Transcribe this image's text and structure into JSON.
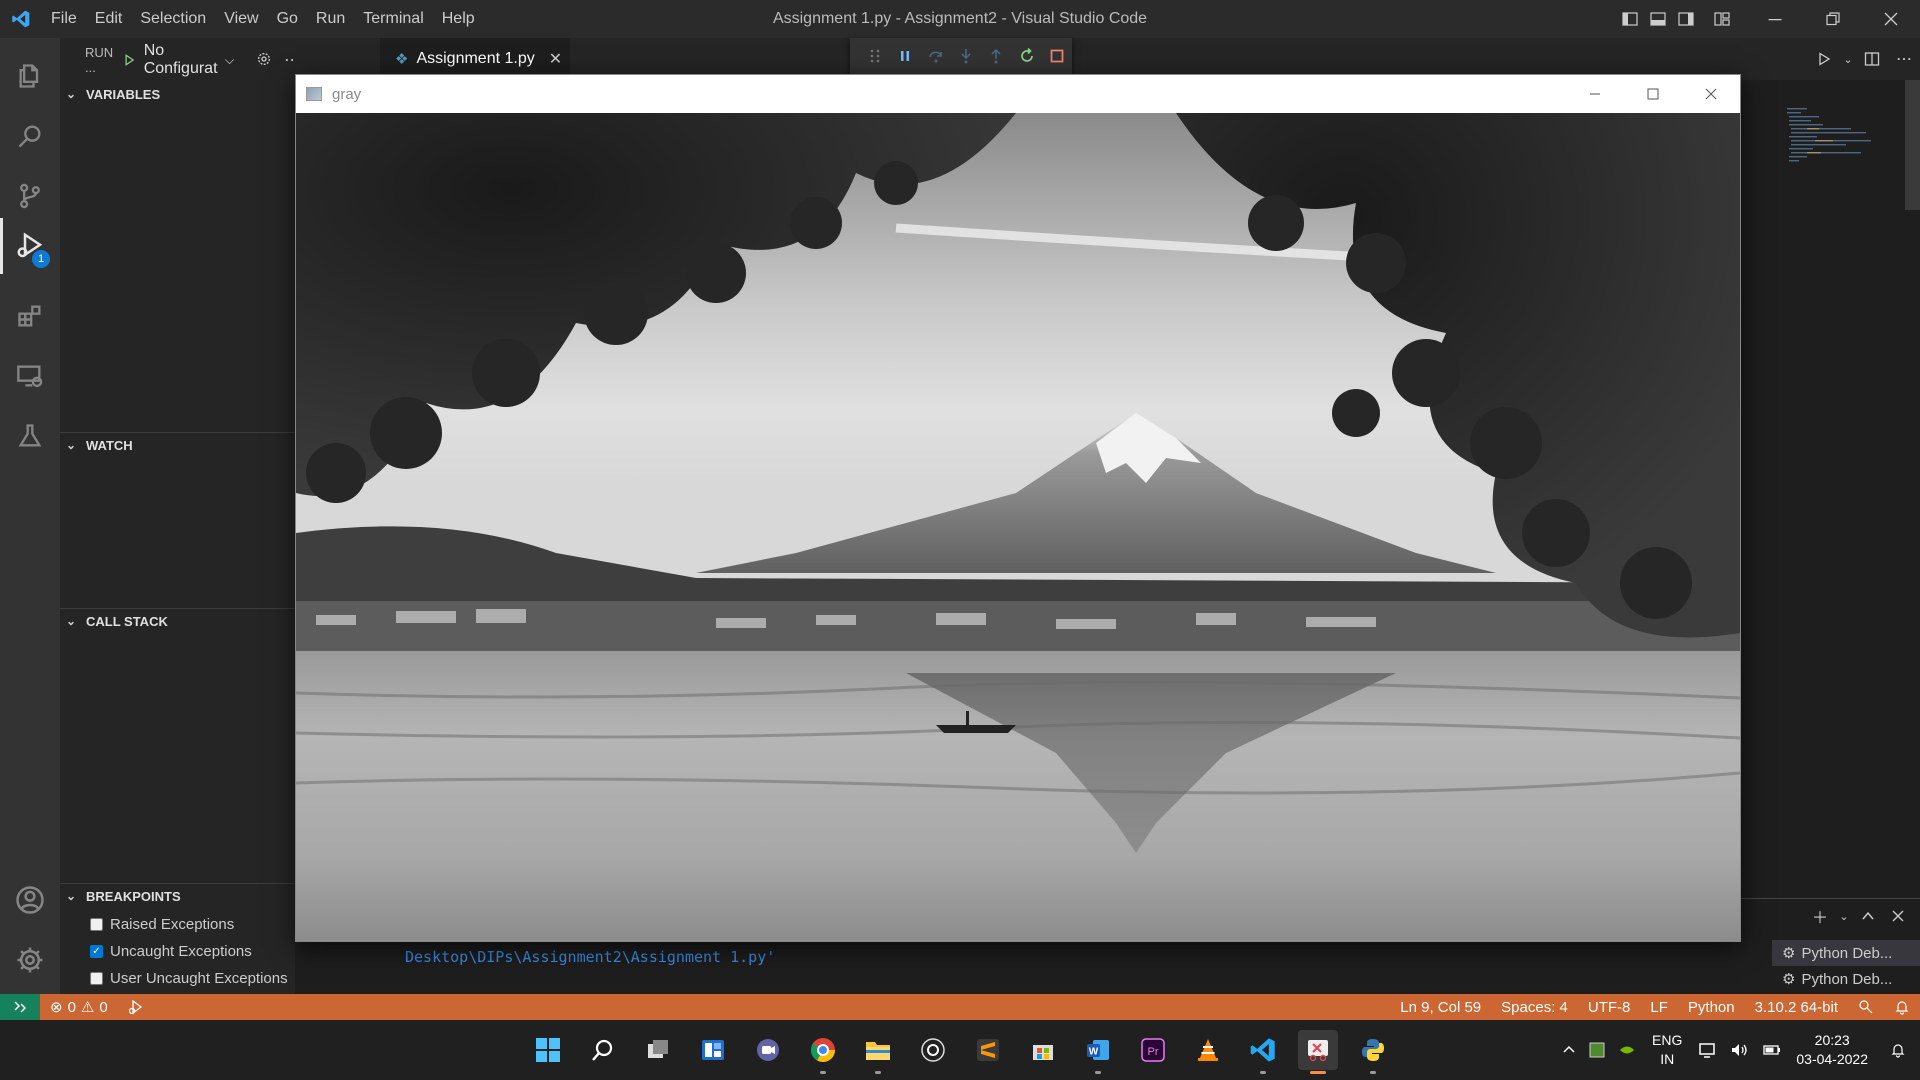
{
  "titlebar": {
    "menu": [
      "File",
      "Edit",
      "Selection",
      "View",
      "Go",
      "Run",
      "Terminal",
      "Help"
    ],
    "window_title": "Assignment 1.py - Assignment2 - Visual Studio Code",
    "icons": [
      "vscode-logo-icon",
      "layout-sidebar-icon",
      "layout-panel-icon",
      "layout-sidebar-right-icon",
      "customize-layout-icon"
    ],
    "window_buttons": [
      "minimize",
      "restore",
      "close"
    ]
  },
  "activitybar": {
    "items": [
      "explorer-icon",
      "search-icon",
      "source-control-icon",
      "run-debug-icon",
      "extensions-icon",
      "remote-explorer-icon",
      "testing-icon",
      "accounts-icon",
      "manage-gear-icon"
    ],
    "debug_badge": "1"
  },
  "sidebar": {
    "run_label": "RUN ...",
    "config": "No Configurat",
    "sections": {
      "variables": "VARIABLES",
      "watch": "WATCH",
      "call_stack": "CALL STACK",
      "breakpoints": "BREAKPOINTS"
    },
    "breakpoints": [
      {
        "label": "Raised Exceptions",
        "checked": false
      },
      {
        "label": "Uncaught Exceptions",
        "checked": true
      },
      {
        "label": "User Uncaught Exceptions",
        "checked": false
      }
    ]
  },
  "editor": {
    "tab_label": "Assignment 1.py",
    "debug_toolbar": [
      "drag-handle-icon",
      "pause-icon",
      "step-over-icon",
      "step-into-icon",
      "step-out-icon",
      "restart-icon",
      "stop-icon"
    ]
  },
  "image_window": {
    "title": "gray",
    "content": "grayscale photo of Mount Fuji framed by maple leaves above a lake with a small boat"
  },
  "panel": {
    "terminal_text": "Desktop\\DIPs\\Assignment2\\Assignment 1.py'",
    "terminals": [
      "Python Deb...",
      "Python Deb..."
    ]
  },
  "statusbar": {
    "errors": "0",
    "warnings": "0",
    "position": "Ln 9, Col 59",
    "spaces": "Spaces: 4",
    "encoding": "UTF-8",
    "eol": "LF",
    "language": "Python",
    "interpreter": "3.10.2 64-bit",
    "colors": {
      "background": "#cc6633",
      "remote": "#16825d"
    }
  },
  "taskbar": {
    "apps": [
      "windows-start-icon",
      "search-icon",
      "task-view-icon",
      "widgets-icon",
      "teams-chat-icon",
      "chrome-icon",
      "file-explorer-icon",
      "obs-icon",
      "sublime-text-icon",
      "microsoft-store-icon",
      "word-icon",
      "premiere-pro-icon",
      "vlc-icon",
      "vscode-icon",
      "snipping-tool-icon",
      "python-icon"
    ],
    "lang_line1": "ENG",
    "lang_line2": "IN",
    "time": "20:23",
    "date": "03-04-2022"
  }
}
